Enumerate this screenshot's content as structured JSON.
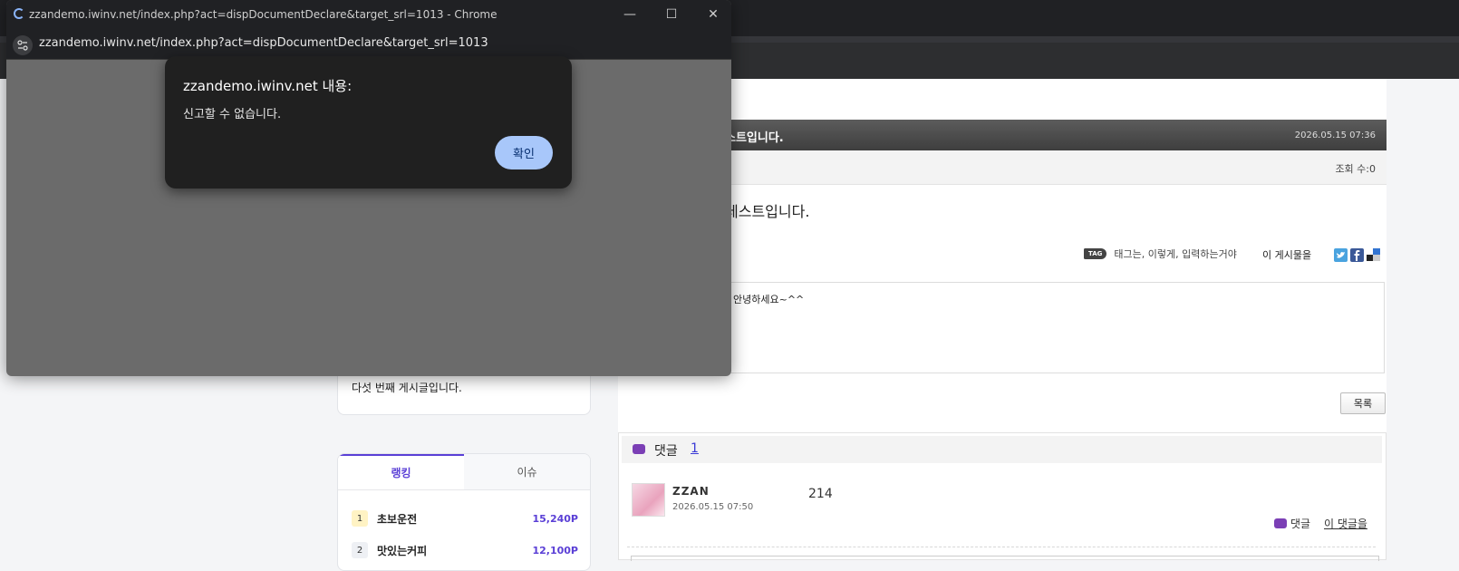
{
  "popup": {
    "window_title": "zzandemo.iwinv.net/index.php?act=dispDocumentDeclare&target_srl=1013 - Chrome",
    "url": "zzandemo.iwinv.net/index.php?act=dispDocumentDeclare&target_srl=1013",
    "controls": {
      "minimize": "—",
      "maximize": "☐",
      "close": "✕"
    }
  },
  "dialog": {
    "title": "zzandemo.iwinv.net 내용:",
    "message": "신고할 수 없습니다.",
    "ok_label": "확인"
  },
  "sidebar": {
    "card_text": "다섯 번째 게시글입니다.",
    "tabs": [
      "랭킹",
      "이슈"
    ],
    "ranking": [
      {
        "rank": "1",
        "name": "초보운전",
        "points": "15,240P"
      },
      {
        "rank": "2",
        "name": "맛있는커피",
        "points": "12,100P"
      }
    ]
  },
  "article": {
    "title_fragment": "스트입니다.",
    "date": "2026.05.15 07:36",
    "views": "조회 수:0",
    "body_fragment": "테스트입니다.",
    "tag_badge": "TAG",
    "tags": "태그는, 이렇게, 입력하는거야",
    "share_label": "이 게시물을",
    "signature_fragment": "안녕하세요~^^",
    "list_button": "목록"
  },
  "comments": {
    "label": "댓글",
    "count": "1",
    "items": [
      {
        "user": "ZZAN",
        "date": "2026.05.15 07:50",
        "text": "214",
        "reply_label": "댓글",
        "this_comment_label": "이 댓글을"
      }
    ]
  },
  "colors": {
    "accent": "#5a3fd6",
    "dialog_button": "#a8c7fa",
    "twitter": "#4aa3df",
    "facebook": "#3b5998"
  }
}
